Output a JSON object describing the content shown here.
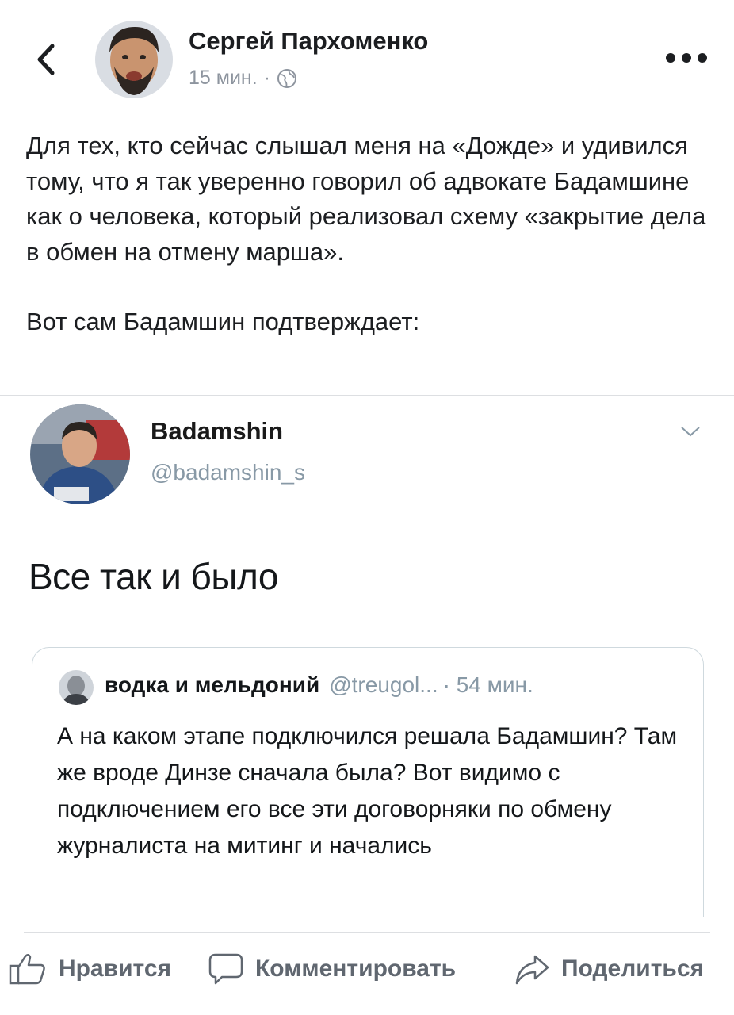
{
  "header": {
    "author": "Сергей Пархоменко",
    "time": "15 мин.",
    "separator": "·",
    "back_icon": "chevron-left-icon",
    "privacy_icon": "globe-icon",
    "more_icon": "more-horizontal-icon"
  },
  "post": {
    "paragraph1": "Для тех, кто сейчас слышал меня на «Дожде» и удивился тому, что я так уверенно говорил об адвокате Бадамшине как о человека, который реализовал схему «закрытие дела в обмен на отмену марша».",
    "paragraph2": "Вот сам Бадамшин подтверждает:"
  },
  "tweet": {
    "name": "Badamshin",
    "handle": "@badamshin_s",
    "text": "Все так и было",
    "caret_icon": "chevron-down-icon"
  },
  "quoted": {
    "name": "водка и мельдоний",
    "handle": "@treugol...",
    "time": "· 54 мин.",
    "text": "А на каком этапе подключился решала Бадамшин? Там же вроде Динзе сначала была? Вот видимо с подключением его все эти договорняки по обмену журналиста на митинг и начались"
  },
  "actions": {
    "like": "Нравится",
    "comment": "Комментировать",
    "share": "Поделиться"
  },
  "colors": {
    "text": "#1c1e21",
    "secondary": "#8d949e",
    "action": "#606770",
    "twitter_secondary": "#8899a6"
  }
}
